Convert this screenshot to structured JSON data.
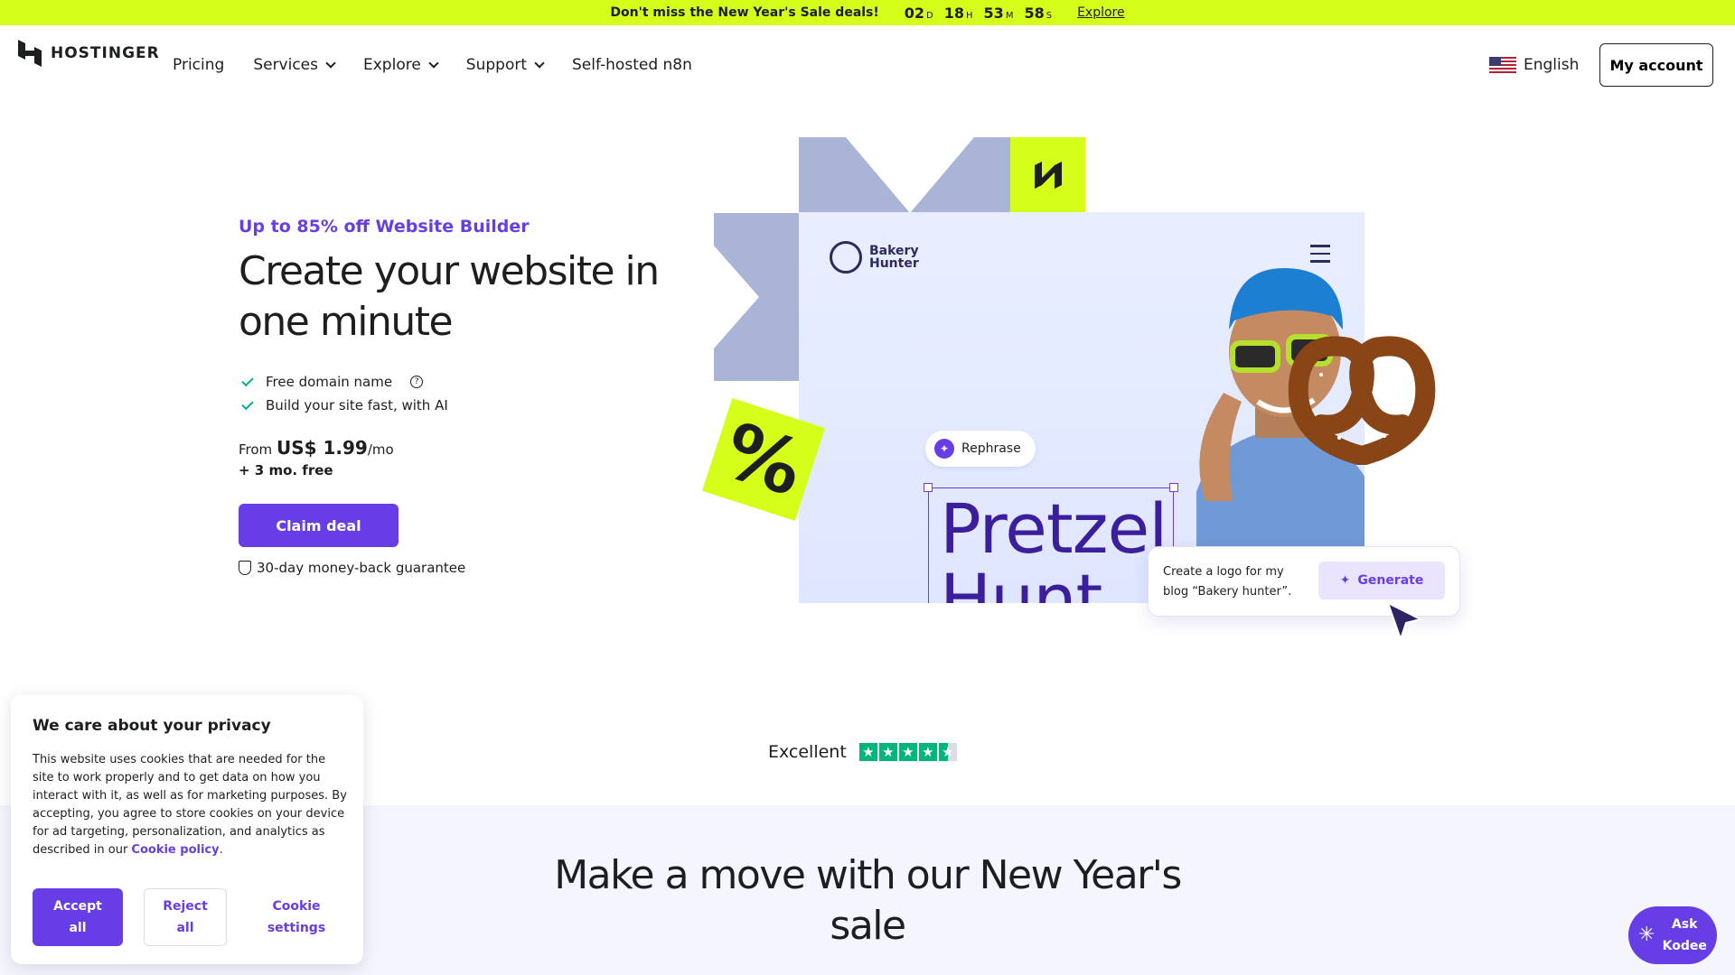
{
  "promo": {
    "message": "Don't miss the New Year's Sale deals!",
    "countdown": [
      {
        "value": "02",
        "unit": "D"
      },
      {
        "value": "18",
        "unit": "H"
      },
      {
        "value": "53",
        "unit": "M"
      },
      {
        "value": "58",
        "unit": "S"
      }
    ],
    "link_label": "Explore",
    "background": "#d5ff1a"
  },
  "header": {
    "logo_text": "HOSTINGER",
    "nav": [
      {
        "label": "Pricing",
        "dropdown": false
      },
      {
        "label": "Services",
        "dropdown": true
      },
      {
        "label": "Explore",
        "dropdown": true
      },
      {
        "label": "Support",
        "dropdown": true
      },
      {
        "label": "Self-hosted n8n",
        "dropdown": false
      }
    ],
    "language": "English",
    "account_button": "My account"
  },
  "hero": {
    "eyebrow": "Up to 85% off Website Builder",
    "title": "Create your website in one minute",
    "features": [
      "Free domain name",
      "Build your site fast, with AI"
    ],
    "price_prefix": "From",
    "price": "US$ 1.99",
    "price_suffix": "/mo",
    "bonus": "+ 3 mo. free",
    "cta": "Claim deal",
    "guarantee": "30-day money-back guarantee"
  },
  "illustration": {
    "brand_name_line1": "Bakery",
    "brand_name_line2": "Hunter",
    "rephrase_label": "Rephrase",
    "headline_line1": "Pretzel",
    "headline_line2": "Hunt",
    "percent_glyph": "%",
    "prompt_text": "Create a logo for my blog “Bakery hunter”.",
    "generate_label": "Generate"
  },
  "rating": {
    "label": "Excellent",
    "stars": 4.5
  },
  "sale": {
    "title": "Make a move with our New Year's sale"
  },
  "cookie": {
    "title": "We care about your privacy",
    "body": "This website uses cookies that are needed for the site to work properly and to get data on how you interact with it, as well as for marketing purposes. By accepting, you agree to store cookies on your device for ad targeting, personalization, and analytics as described in our ",
    "policy_link": "Cookie policy",
    "body_end": ".",
    "accept_line1": "Accept",
    "accept_line2": "all",
    "reject_line1": "Reject",
    "reject_line2": "all",
    "settings_line1": "Cookie",
    "settings_line2": "settings"
  },
  "kodee": {
    "line1": "Ask",
    "line2": "Kodee"
  },
  "colors": {
    "accent": "#673de6",
    "lime": "#d5ff1a",
    "check": "#00b090",
    "trustpilot": "#00b67a"
  }
}
